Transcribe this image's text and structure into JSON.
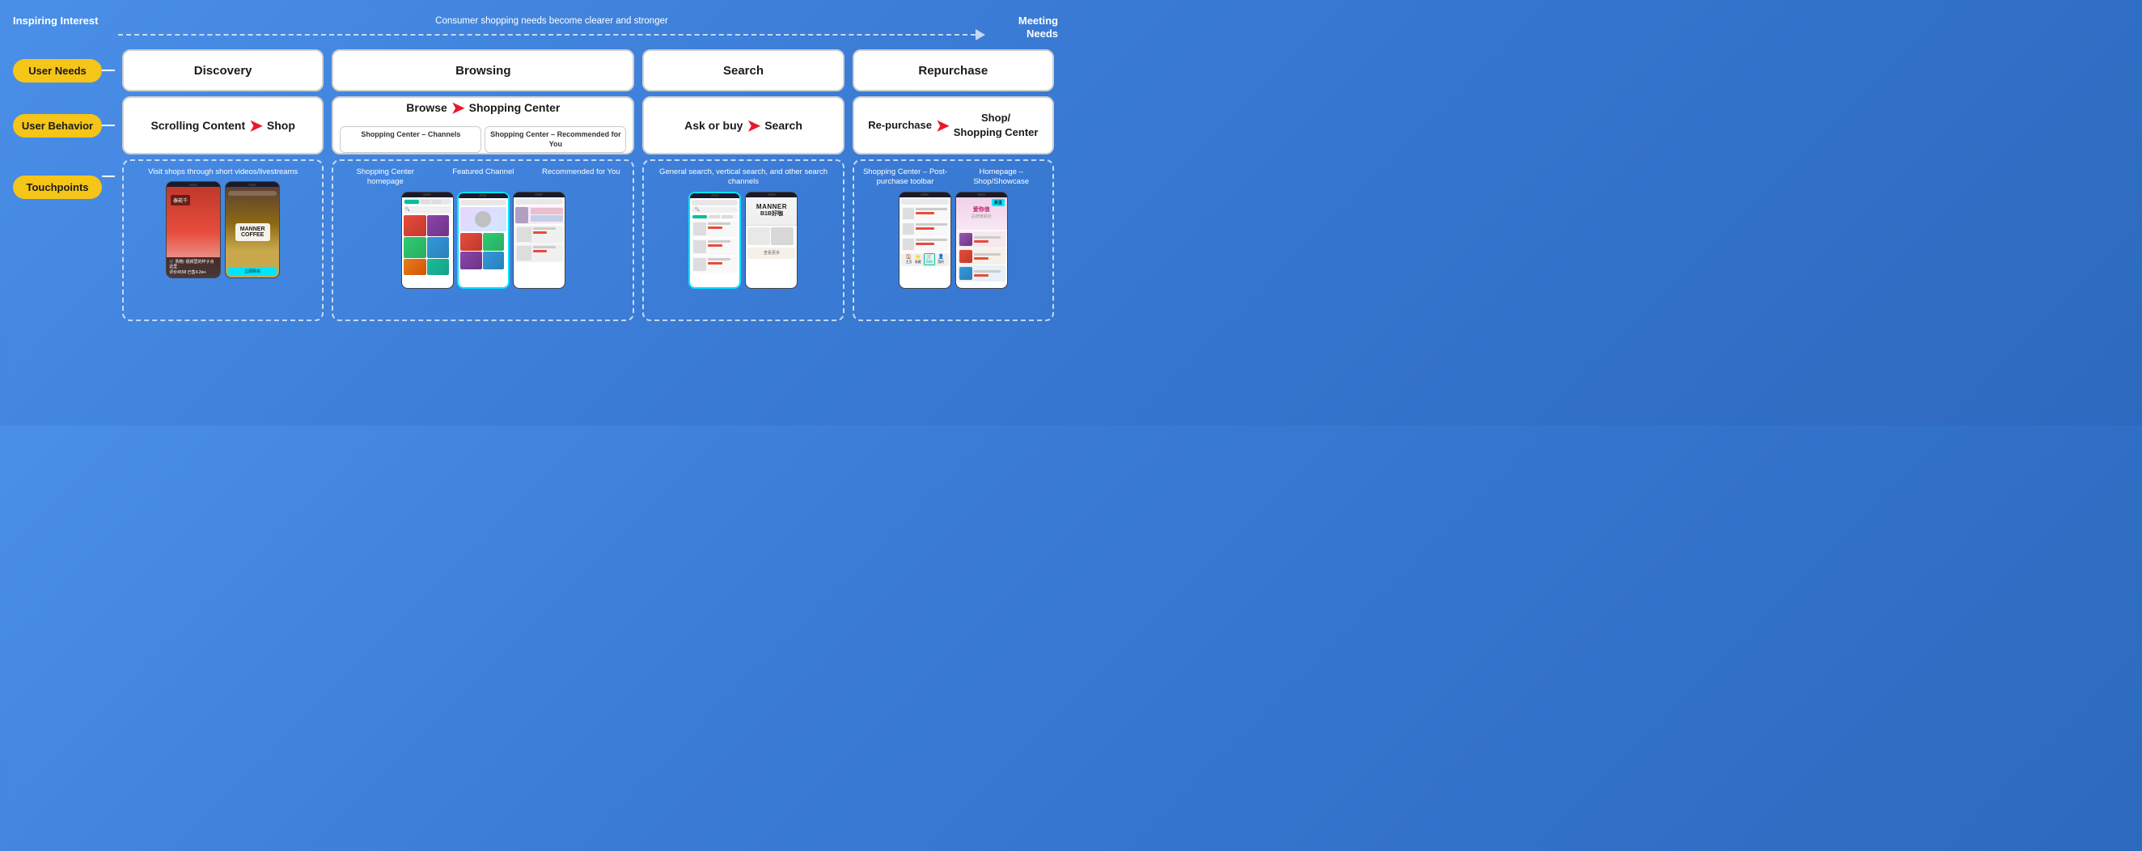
{
  "header": {
    "inspiring_label": "Inspiring Interest",
    "meeting_label": "Meeting Needs",
    "arrow_text": "Consumer shopping needs become clearer and stronger"
  },
  "row_labels": {
    "user_needs": "User Needs",
    "user_behavior": "User Behavior",
    "touchpoints": "Touchpoints"
  },
  "sections": {
    "discovery": {
      "label": "Discovery",
      "behavior_main": "Scrolling Content",
      "behavior_arrow": "→",
      "behavior_target": "Shop",
      "touchpoints_label": "Visit shops through short videos/livestreams"
    },
    "browsing": {
      "label": "Browsing",
      "behavior_main": "Browse",
      "behavior_arrow": "→",
      "behavior_target": "Shopping Center",
      "sub1": "Shopping Center – Channels",
      "sub2": "Shopping Center – Recommended for You",
      "tp_label1": "Shopping Center homepage",
      "tp_label2": "Featured Channel",
      "tp_label3": "Recommended for You"
    },
    "search": {
      "label": "Search",
      "behavior_main": "Ask or buy",
      "behavior_arrow": "→",
      "behavior_target": "Search",
      "touchpoints_label": "General search, vertical search, and other search channels"
    },
    "repurchase": {
      "label": "Repurchase",
      "behavior_main": "Re-purchase",
      "behavior_arrow": "→",
      "behavior_target1": "Shop/",
      "behavior_target2": "Shopping Center",
      "tp_label1": "Shopping Center – Post-purchase toolbar",
      "tp_label2": "Homepage – Shop/Showcase"
    }
  },
  "colors": {
    "pill_bg": "#f5c518",
    "pill_text": "#1a1a1a",
    "white": "#ffffff",
    "red_arrow": "#e8192c",
    "border": "#d0d0d0",
    "dashed_border": "rgba(255,255,255,0.7)",
    "cyan_highlight": "#00e5ff"
  }
}
